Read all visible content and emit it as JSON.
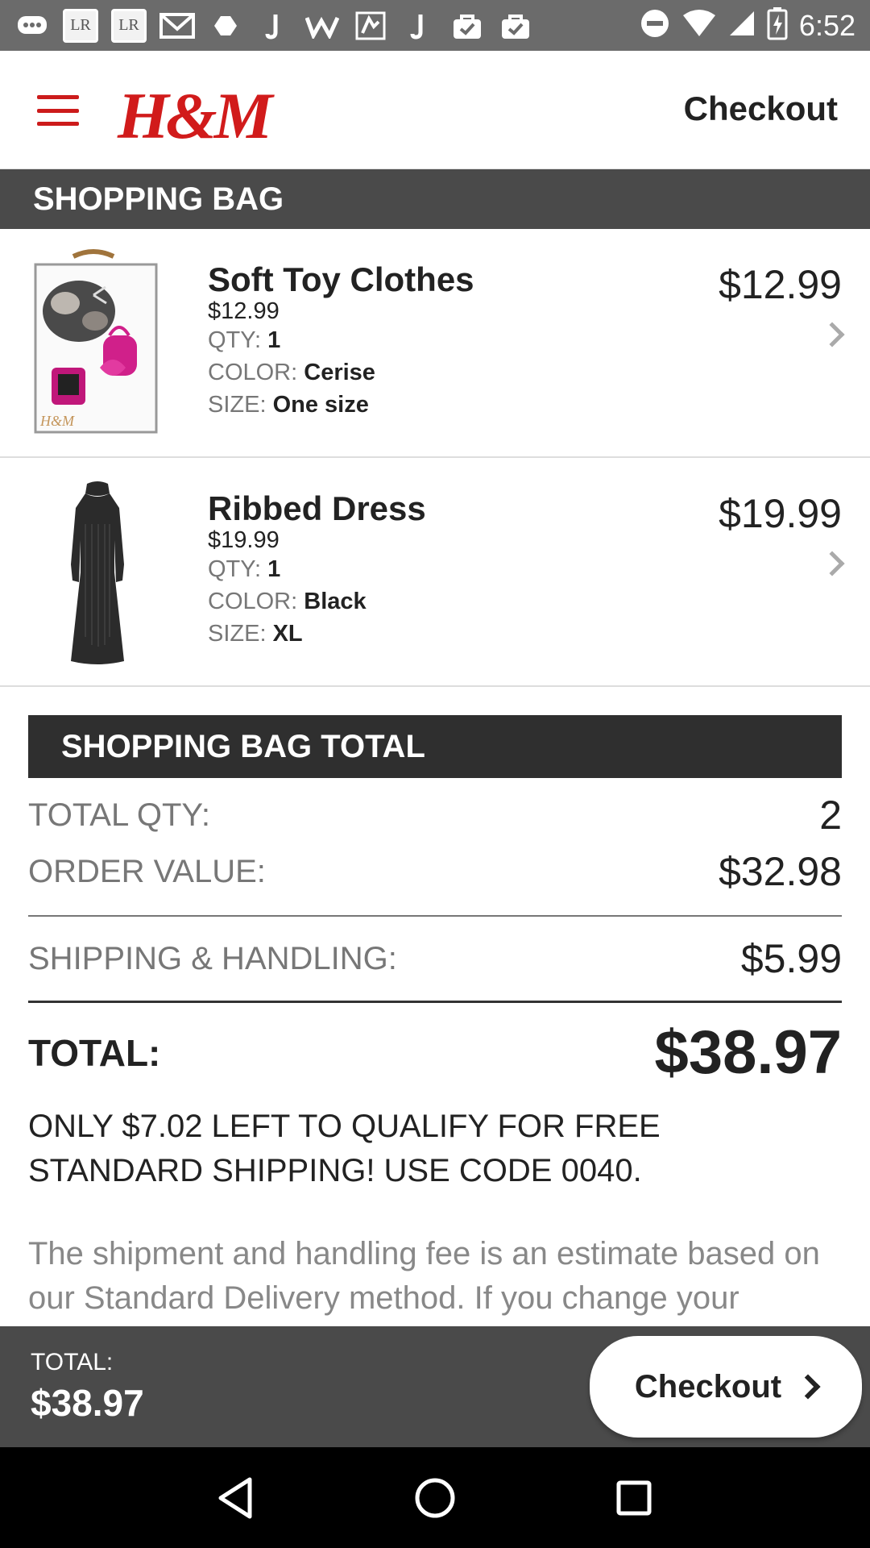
{
  "status_bar": {
    "time": "6:52",
    "left_icons": [
      "chat-icon",
      "lr-icon",
      "lr-icon",
      "mail-icon",
      "photo-icon",
      "j-icon",
      "w-icon",
      "map-icon",
      "j-icon",
      "bag-icon",
      "bag-icon"
    ],
    "right_icons": [
      "dnd-icon",
      "wifi-icon",
      "signal-icon",
      "battery-icon"
    ]
  },
  "header": {
    "logo": "H&M",
    "title": "Checkout"
  },
  "shopping_bag": {
    "title": "SHOPPING BAG",
    "items": [
      {
        "name": "Soft Toy Clothes",
        "unit_price": "$12.99",
        "qty_label": "QTY:",
        "qty": "1",
        "color_label": "COLOR:",
        "color": "Cerise",
        "size_label": "SIZE:",
        "size": "One size",
        "price": "$12.99"
      },
      {
        "name": "Ribbed Dress",
        "unit_price": "$19.99",
        "qty_label": "QTY:",
        "qty": "1",
        "color_label": "COLOR:",
        "color": "Black",
        "size_label": "SIZE:",
        "size": "XL",
        "price": "$19.99"
      }
    ]
  },
  "totals": {
    "title": "SHOPPING BAG TOTAL",
    "total_qty_label": "TOTAL QTY:",
    "total_qty": "2",
    "order_value_label": "ORDER VALUE:",
    "order_value": "$32.98",
    "shipping_label": "SHIPPING & HANDLING:",
    "shipping": "$5.99",
    "total_label": "TOTAL:",
    "total": "$38.97"
  },
  "promo": "ONLY $7.02 LEFT TO QUALIFY FOR FREE STANDARD SHIPPING! USE CODE 0040.",
  "note": "The shipment and handling fee is an estimate based on our Standard Delivery method. If you change your",
  "checkout_bar": {
    "total_label": "TOTAL:",
    "total": "$38.97",
    "button_label": "Checkout"
  },
  "colors": {
    "brand_red": "#cc1b1b",
    "dark_bar": "#4a4a4a",
    "totals_bar": "#2f2f2f"
  }
}
